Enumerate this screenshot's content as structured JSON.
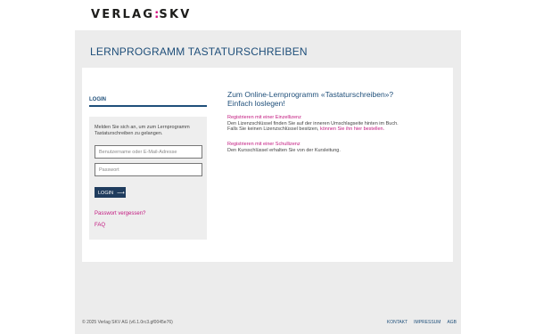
{
  "brand": {
    "logo_left": "VERLAG",
    "logo_colon": ":",
    "logo_right": "SKV"
  },
  "page": {
    "title": "LERNPROGRAMM TASTATURSCHREIBEN"
  },
  "login": {
    "heading": "LOGIN",
    "intro": "Melden Sie sich an, um zum Lernprogramm Tastaturschreiben zu gelangen.",
    "username_placeholder": "Benutzername oder E-Mail-Adresse",
    "password_placeholder": "Passwort",
    "button_label": "LOGIN",
    "button_arrow": "⟶",
    "forgot_password": "Passwort vergessen?",
    "faq": "FAQ"
  },
  "info": {
    "heading_line1": "Zum Online-Lernprogramm «Tastaturschreiben»?",
    "heading_line2": "Einfach loslegen!",
    "single": {
      "link": "Registrieren mit einer Einzellizenz",
      "line1": "Den Lizenzschlüssel finden Sie auf der inneren Umschlagseite hinten im Buch.",
      "line2_text": "Falls Sie keinen Lizenzschlüssel besitzen, ",
      "line2_link": "können Sie ihn hier bestellen."
    },
    "school": {
      "link": "Registrieren mit einer Schullizenz",
      "line1": "Den Kursschlüssel erhalten Sie von der Kursleitung."
    }
  },
  "footer": {
    "copyright": "© 2025 Verlag SKV AG (v6.1.0rc3.gf0045e76)",
    "links": [
      "KONTAKT",
      "IMPRESSUM",
      "AGB"
    ]
  },
  "colors": {
    "accent": "#1f4f7a",
    "link": "#c2187f",
    "button": "#1f3c5e"
  }
}
